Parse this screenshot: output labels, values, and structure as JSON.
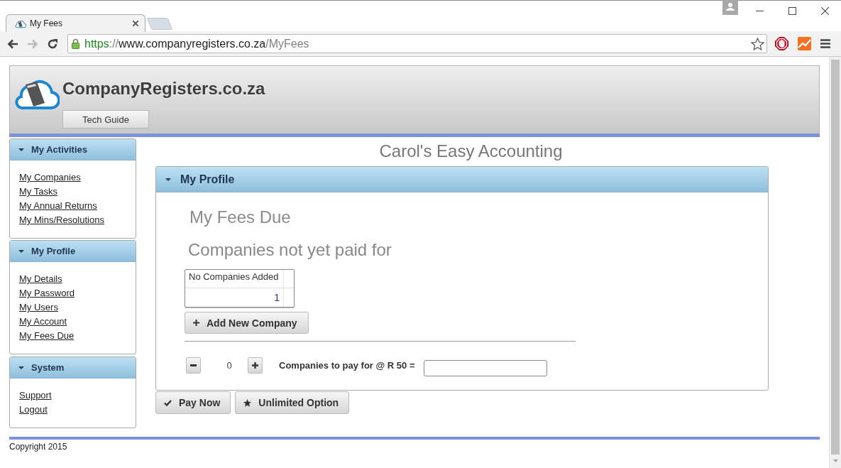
{
  "browser": {
    "tabs": [
      {
        "title": "My Fees",
        "selected": true
      }
    ],
    "navigation": {
      "back_disabled": false,
      "forward_disabled": true
    },
    "address": {
      "scheme": "https",
      "separator": "://",
      "host": "www.companyregisters.co.za",
      "path": "/MyFees"
    }
  },
  "site_header": {
    "title": "CompanyRegisters.co.za",
    "button": "Tech Guide"
  },
  "sidebar": {
    "panels": [
      {
        "title": "My Activities",
        "expanded": true,
        "links": [
          "My Companies",
          "My Tasks",
          "My Annual Returns",
          "My Mins/Resolutions"
        ]
      },
      {
        "title": "My Profile",
        "expanded": true,
        "links": [
          "My Details",
          "My Password",
          "My Users",
          "My Account",
          "My Fees Due"
        ]
      },
      {
        "title": "System",
        "expanded": true,
        "links": [
          "Support",
          "Logout"
        ]
      }
    ]
  },
  "main": {
    "page_title": "Carol's Easy Accounting",
    "panel": {
      "title": "My Profile",
      "expanded": true,
      "heading": "My Fees Due",
      "subheading": "Companies not yet paid for",
      "table": {
        "columns": [
          "No Companies Added"
        ],
        "rows": [
          [
            "1"
          ]
        ]
      },
      "add_button": "Add New Company",
      "counter": "0",
      "pay_label": "Companies to pay for @ R 50 ="
    },
    "actions": [
      {
        "label": "Pay Now",
        "kind": "check"
      },
      {
        "label": "Unlimited Option",
        "kind": "star"
      }
    ]
  },
  "footer": {
    "copyright": "Copyright 2015"
  }
}
